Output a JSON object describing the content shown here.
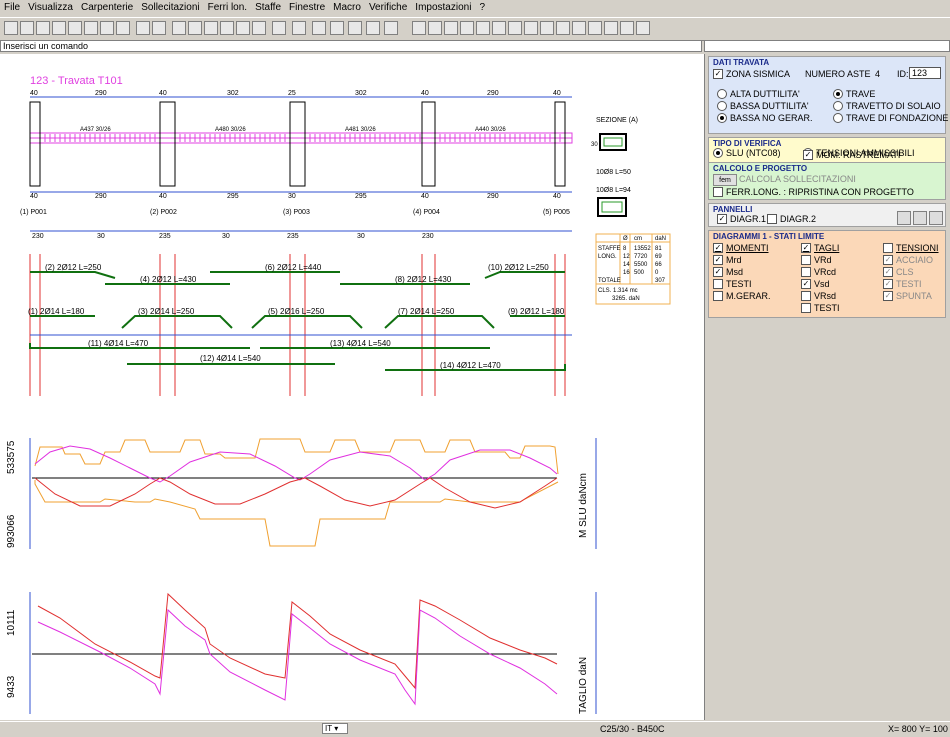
{
  "menu": [
    "File",
    "Visualizza",
    "Carpenterie",
    "Sollecitazioni",
    "Ferri lon.",
    "Staffe",
    "Finestre",
    "Macro",
    "Verifiche",
    "Impostazioni",
    "?"
  ],
  "command": {
    "placeholder": "Inserisci un comando"
  },
  "drawing": {
    "title": "123 - Travata T101",
    "top_dims": [
      "40",
      "290",
      "40",
      "302",
      "25",
      "302",
      "40",
      "290",
      "40"
    ],
    "bottom_dims": [
      "40",
      "290",
      "40",
      "295",
      "30",
      "295",
      "40",
      "290",
      "40"
    ],
    "beam_labels": [
      "A437 30/26",
      "A480 30/26",
      "A481 30/26",
      "A440 30/26"
    ],
    "pillars": [
      "(1) P001",
      "(2) P002",
      "(3) P003",
      "(4) P004",
      "(5) P005"
    ],
    "stirrup_zones": [
      "230",
      "30",
      "235",
      "30",
      "235",
      "30",
      "230"
    ],
    "section_label": "SEZIONE (A)",
    "section_dim": "30",
    "stirrup_text": [
      "10Ø8 L=50",
      "10Ø8 L=94"
    ],
    "bars_top": [
      "(2) 2Ø12 L=250",
      "(4) 2Ø12 L=430",
      "(6) 2Ø12 L=440",
      "(8) 2Ø12 L=430",
      "(10) 2Ø12 L=250"
    ],
    "bars_mid": [
      "(1) 2Ø14 L=180",
      "(3) 2Ø14 L=250",
      "(5) 2Ø16 L=250",
      "(7) 2Ø14 L=250",
      "(9) 2Ø12 L=180"
    ],
    "bars_bottom": [
      "(11) 4Ø14 L=470",
      "(13) 4Ø14 L=540",
      "(12) 4Ø14 L=540",
      "(14) 4Ø12 L=470"
    ],
    "table_header": [
      "Ø",
      "cm",
      "daN"
    ],
    "table_rows": [
      [
        "STAFFE",
        "8",
        "13552",
        "81"
      ],
      [
        "LONG.",
        "12",
        "7720",
        "69"
      ],
      [
        "",
        "14",
        "5500",
        "66"
      ],
      [
        "",
        "16",
        "500",
        "0"
      ],
      [
        "TOTALE",
        "",
        "",
        "307"
      ]
    ],
    "cls": "CLS. 1.314 mc",
    "weight": "3265. daN",
    "moment_top": "533575",
    "moment_bottom": "993066",
    "moment_label": "M SLU  daNcm",
    "shear_top": "10111",
    "shear_bottom": "9433",
    "shear_label": "TAGLIO daN"
  },
  "panel": {
    "dati": {
      "title": "DATI TRAVATA",
      "zona_sismica": "ZONA SISMICA",
      "numero_aste_label": "NUMERO ASTE",
      "numero_aste": "4",
      "id_label": "ID:",
      "id_value": "123",
      "duttilita": [
        "ALTA DUTTILITA'",
        "BASSA DUTTILITA'",
        "BASSA NO GERAR."
      ],
      "tipo": [
        "TRAVE",
        "TRAVETTO DI SOLAIO",
        "TRAVE DI FONDAZIONE"
      ]
    },
    "verifica": {
      "title": "TIPO DI VERIFICA",
      "slu": "SLU (NTC08)",
      "tensioni": "TENSIONI AMMISSIBILI",
      "mom": "MOM. RASTREMATI"
    },
    "calcolo": {
      "title": "CALCOLO E PROGETTO",
      "btn": "fem",
      "calcola": "CALCOLA SOLLECITAZIONI",
      "ferr": "FERR.LONG. : RIPRISTINA CON PROGETTO"
    },
    "pannelli": {
      "title": "PANNELLI",
      "d1": "DIAGR.1",
      "d2": "DIAGR.2"
    },
    "diagrammi": {
      "title": "DIAGRAMMI 1 - STATI LIMITE",
      "col1": [
        "MOMENTI",
        "Mrd",
        "Msd",
        "TESTI",
        "M.GERAR."
      ],
      "col2": [
        "TAGLI",
        "VRd",
        "VRcd",
        "Vsd",
        "VRsd",
        "TESTI"
      ],
      "col3": [
        "TENSIONI",
        "ACCIAIO",
        "CLS",
        "TESTI",
        "SPUNTA"
      ]
    }
  },
  "status": {
    "lang": "IT",
    "materials": "C25/30 - B450C",
    "coords": "X= 800 Y= 100"
  },
  "colors": {
    "panel_blue": "#dce6f8",
    "panel_yellow": "#fffbcc",
    "panel_green": "#d8f5d0",
    "panel_white": "#f0f0f0",
    "panel_orange": "#fbd8b8"
  }
}
